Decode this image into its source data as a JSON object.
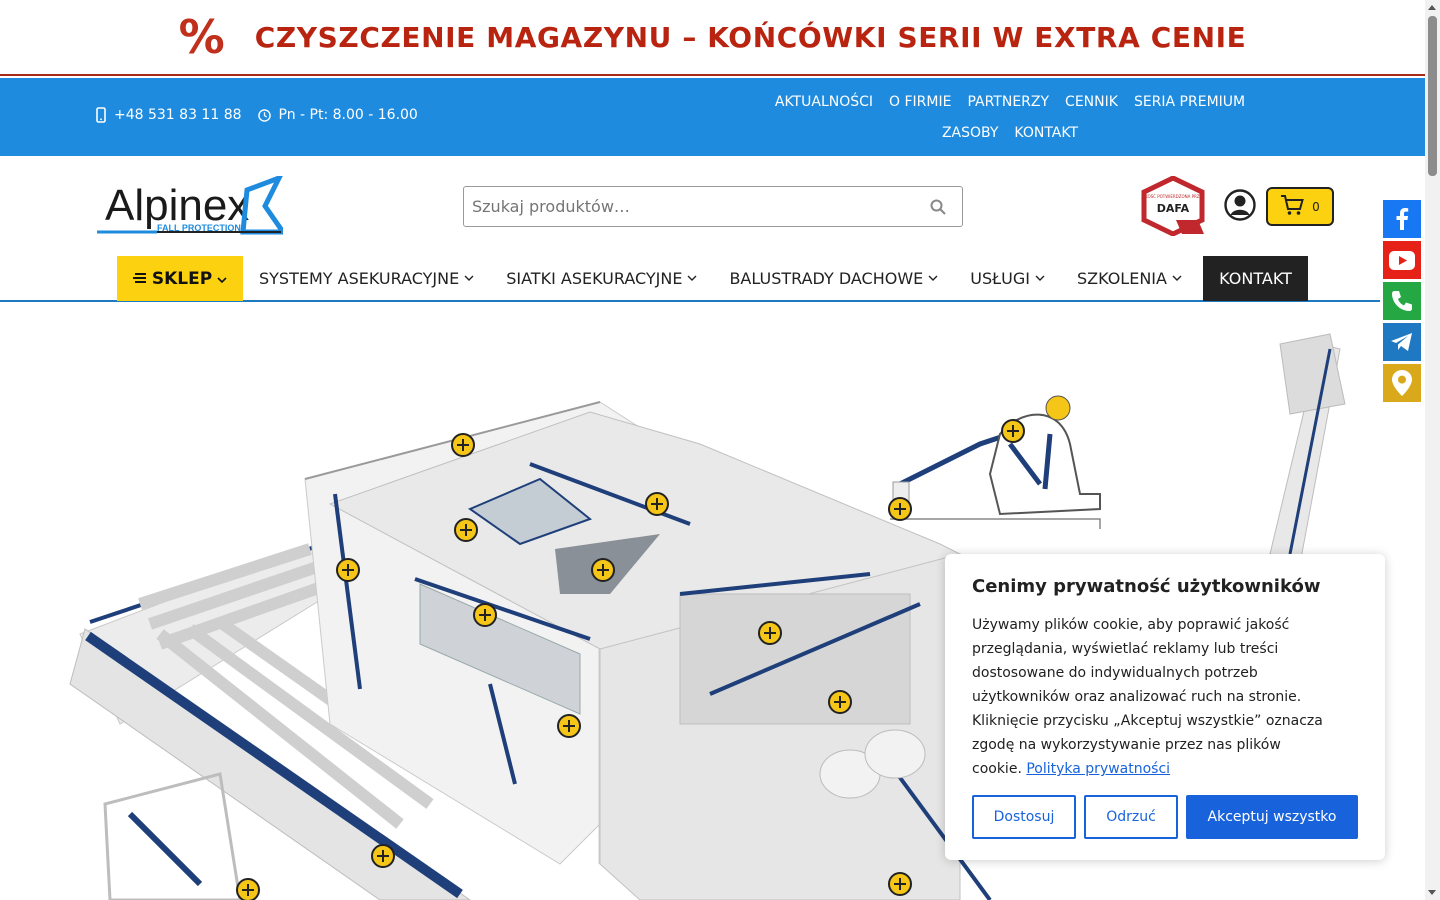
{
  "promo": {
    "icon": "percent-icon",
    "text": "CZYSZCZENIE MAGAZYNU – KOŃCÓWKI SERII W EXTRA CENIE",
    "color": "#b8240f"
  },
  "topbar": {
    "phone": "+48 531 83 11 88",
    "hours": "Pn - Pt: 8.00 - 16.00",
    "nav": [
      "AKTUALNOŚCI",
      "O FIRMIE",
      "PARTNERZY",
      "CENNIK",
      "SERIA PREMIUM",
      "ZASOBY",
      "KONTAKT"
    ],
    "color": "#1e8bdf"
  },
  "header": {
    "logo_text": "Alpinex",
    "logo_tagline": "FALL PROTECTION",
    "search_placeholder": "Szukaj produktów…",
    "badge_small": "JAKOŚĆ POTWIERDZONA PRZEZ",
    "badge_text": "DAFA",
    "cart_count": "0"
  },
  "mainnav": {
    "shop": "SKLEP",
    "items": [
      "SYSTEMY ASEKURACYJNE",
      "SIATKI ASEKURACYJNE",
      "BALUSTRADY DACHOWE",
      "USŁUGI",
      "SZKOLENIA"
    ],
    "contact": "KONTAKT",
    "accent": "#fcd210"
  },
  "social": [
    "facebook-icon",
    "youtube-icon",
    "phone-icon",
    "telegram-icon",
    "location-pin-icon"
  ],
  "cookie": {
    "title": "Cenimy prywatność użytkowników",
    "body": "Używamy plików cookie, aby poprawić jakość przeglądania, wyświetlać reklamy lub treści dostosowane do indywidualnych potrzeb użytkowników oraz analizować ruch na stronie. Kliknięcie przycisku „Akceptuj wszystkie” oznacza zgodę na wykorzystywanie przez nas plików cookie.",
    "link": "Polityka prywatności",
    "btn_customize": "Dostosuj",
    "btn_reject": "Odrzuć",
    "btn_accept": "Akceptuj wszystko"
  }
}
